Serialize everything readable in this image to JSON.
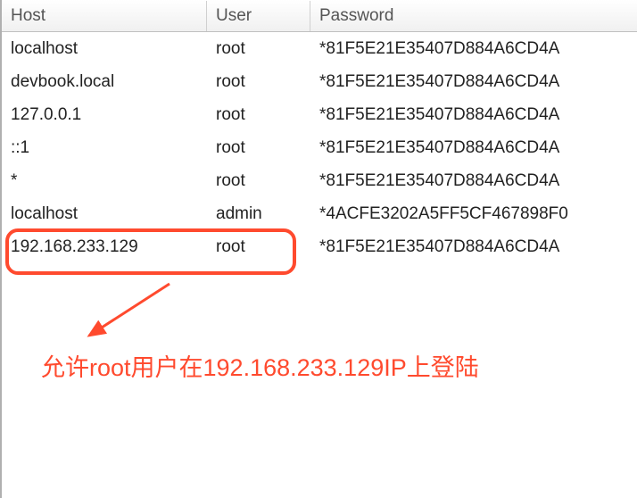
{
  "columns": {
    "host": "Host",
    "user": "User",
    "password": "Password"
  },
  "rows": [
    {
      "host": "localhost",
      "user": "root",
      "password": "*81F5E21E35407D884A6CD4A"
    },
    {
      "host": "devbook.local",
      "user": "root",
      "password": "*81F5E21E35407D884A6CD4A"
    },
    {
      "host": "127.0.0.1",
      "user": "root",
      "password": "*81F5E21E35407D884A6CD4A"
    },
    {
      "host": "::1",
      "user": "root",
      "password": "*81F5E21E35407D884A6CD4A"
    },
    {
      "host": "*",
      "user": "root",
      "password": "*81F5E21E35407D884A6CD4A"
    },
    {
      "host": "localhost",
      "user": "admin",
      "password": "*4ACFE3202A5FF5CF467898F0"
    },
    {
      "host": "192.168.233.129",
      "user": "root",
      "password": "*81F5E21E35407D884A6CD4A"
    }
  ],
  "annotation": "允许root用户在192.168.233.129IP上登陆",
  "highlight": {
    "rowIndex": 6,
    "color": "#ff4a2e"
  }
}
